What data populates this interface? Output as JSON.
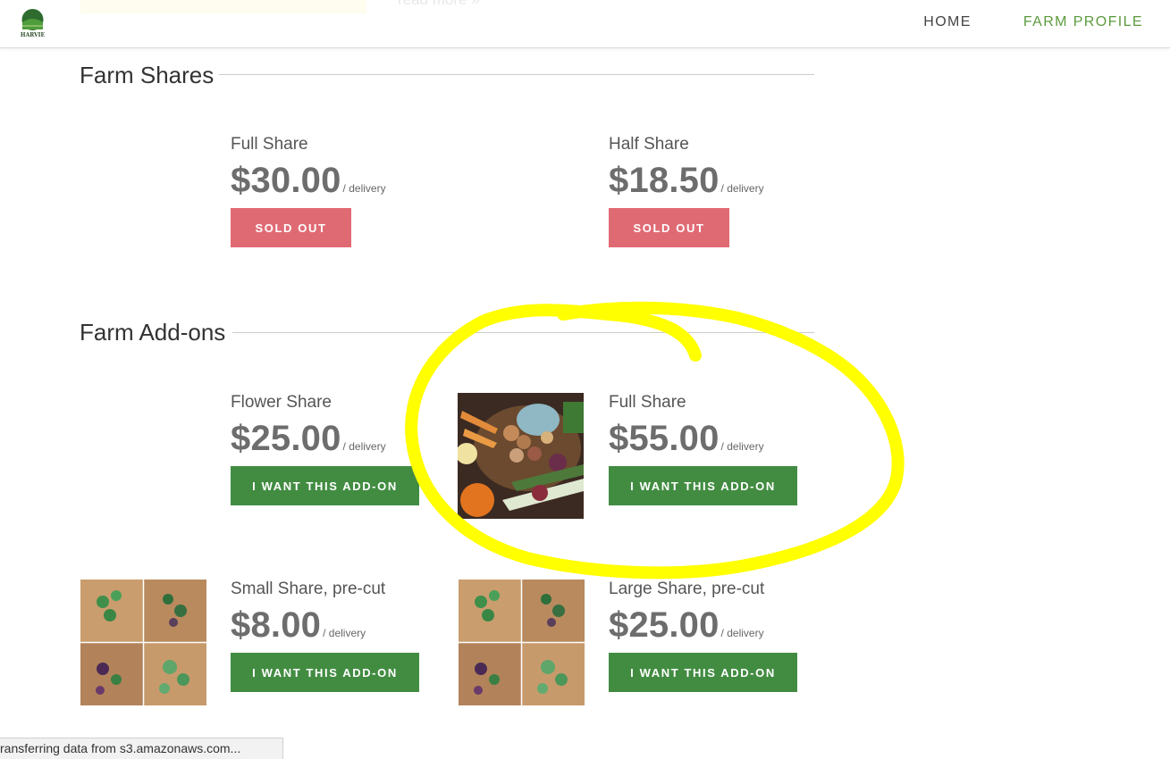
{
  "nav": {
    "home": "HOME",
    "farm_profile": "FARM PROFILE",
    "ghost_link": "read more »",
    "logo_text": "HARVIE"
  },
  "shares": {
    "title": "Farm Shares",
    "items": [
      {
        "name": "Full Share",
        "price": "$30.00",
        "unit": "/ delivery",
        "button": "SOLD OUT"
      },
      {
        "name": "Half Share",
        "price": "$18.50",
        "unit": "/ delivery",
        "button": "SOLD OUT"
      }
    ]
  },
  "addons": {
    "title": "Farm Add-ons",
    "items": [
      {
        "name": "Flower Share",
        "price": "$25.00",
        "unit": "/ delivery",
        "button": "I WANT THIS ADD-ON"
      },
      {
        "name": "Full Share",
        "price": "$55.00",
        "unit": "/ delivery",
        "button": "I WANT THIS ADD-ON"
      },
      {
        "name": "Small Share, pre-cut",
        "price": "$8.00",
        "unit": "/ delivery",
        "button": "I WANT THIS ADD-ON"
      },
      {
        "name": "Large Share, pre-cut",
        "price": "$25.00",
        "unit": "/ delivery",
        "button": "I WANT THIS ADD-ON"
      }
    ]
  },
  "status_bar": "ransferring data from s3.amazonaws.com...",
  "colors": {
    "sold_out": "#e06a74",
    "add_button": "#428c42",
    "nav_active": "#5c9a3e",
    "highlight": "#ffff00"
  }
}
